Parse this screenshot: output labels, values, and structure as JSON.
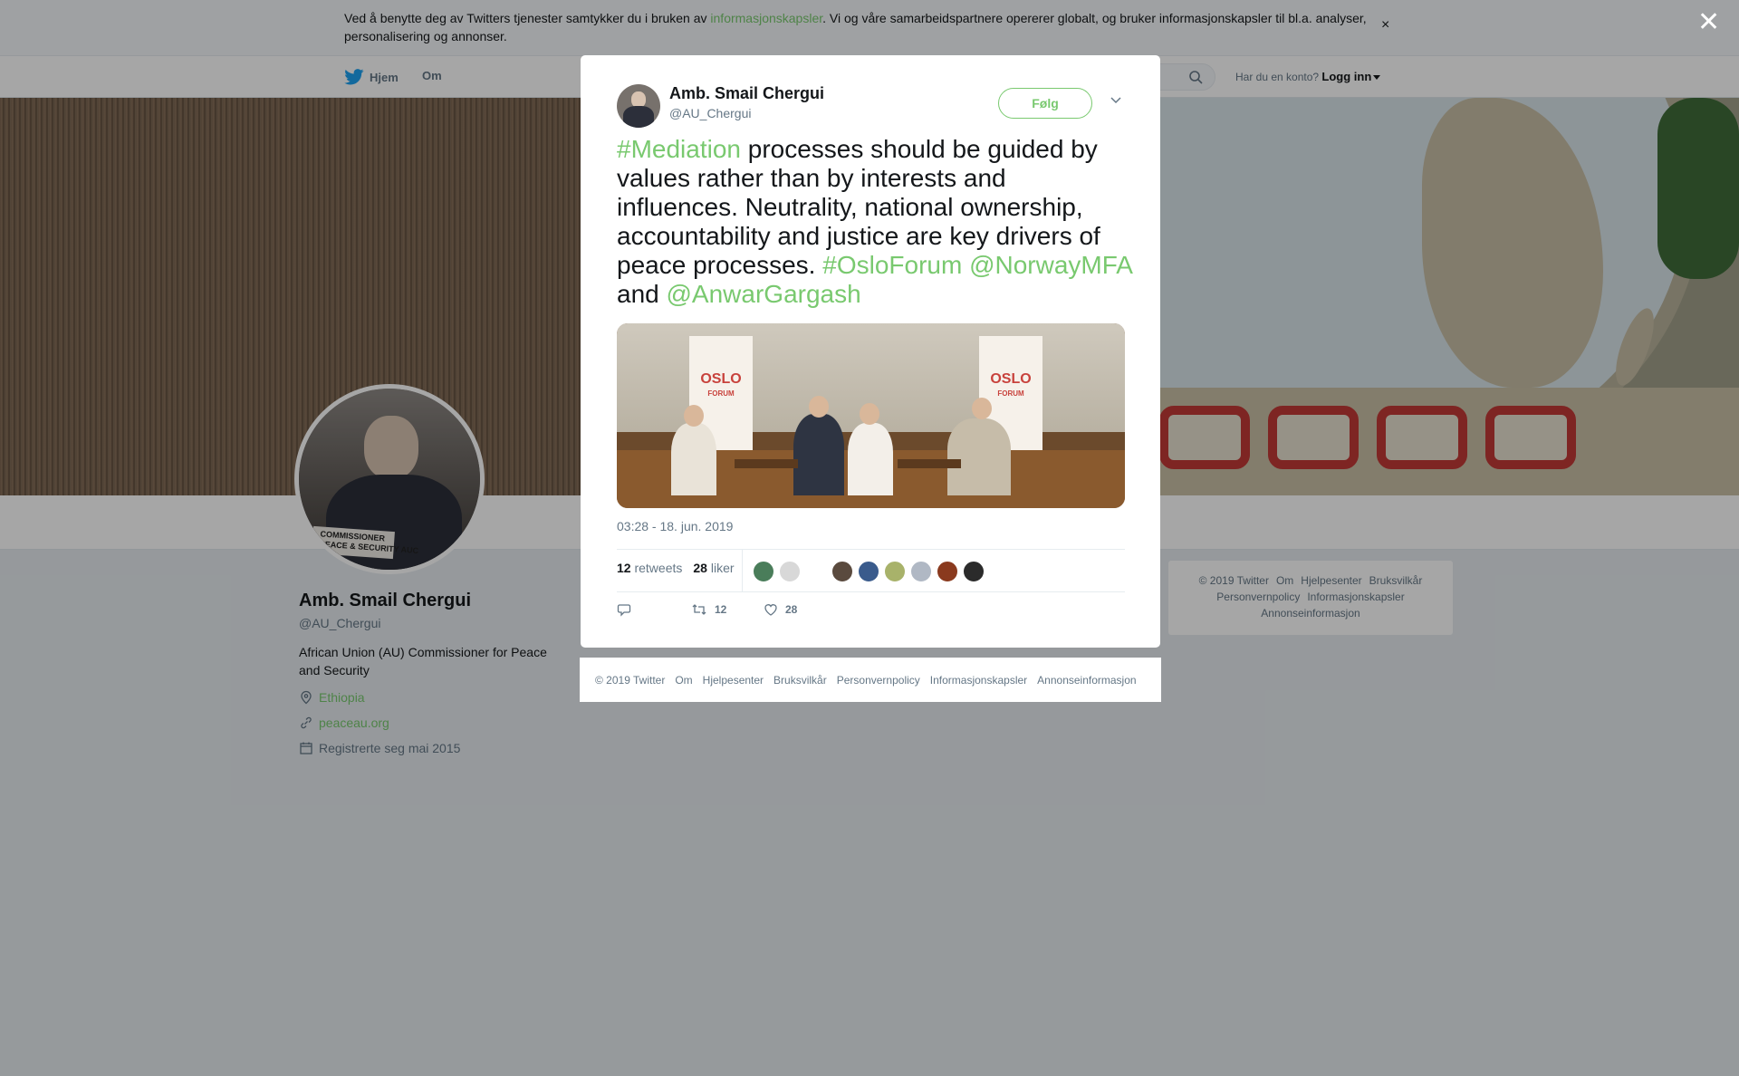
{
  "cookie_banner": {
    "text_before": "Ved å benytte deg av Twitters tjenester samtykker du i bruken av ",
    "link": "informasjonskapsler",
    "text_after": ". Vi og våre samarbeidspartnere opererer globalt, og bruker informasjonskapsler til bl.a. analyser, personalisering og annonser.",
    "close_glyph": "×"
  },
  "nav": {
    "home": "Hjem",
    "about": "Om",
    "account_prompt": "Har du en konto?",
    "login": "Logg inn"
  },
  "profile": {
    "name": "Amb. Smail Chergui",
    "handle": "@AU_Chergui",
    "bio": "African Union (AU) Commissioner for Peace and Security",
    "location": "Ethiopia",
    "website": "peaceau.org",
    "joined": "Registrerte seg mai 2015",
    "avatar_plate": "COMMISSIONER\nPEACE & SECURITY AUC"
  },
  "right_footer": {
    "items": [
      "© 2019 Twitter",
      "Om",
      "Hjelpesenter",
      "Bruksvilkår",
      "Personvernpolicy",
      "Informasjonskapsler",
      "Annonseinformasjon"
    ]
  },
  "tweet": {
    "author_name": "Amb. Smail Chergui",
    "author_handle": "@AU_Chergui",
    "follow_label": "Følg",
    "text": {
      "tag1": "#Mediation",
      "body": " processes should be guided by values rather than by interests and influences. Neutrality, national ownership, accountability and justice are key drivers of peace processes. ",
      "tag2": "#OsloForum",
      "mention1": "@NorwayMFA",
      "and": " and ",
      "mention2": "@AnwarGargash"
    },
    "photo_banner_text": "OSLO",
    "photo_banner_sub": "FORUM",
    "timestamp": "03:28 - 18. jun. 2019",
    "retweets_count": "12",
    "retweets_label": "retweets",
    "likes_count": "28",
    "likes_label": "liker",
    "action_retweets": "12",
    "action_likes": "28",
    "liker_colors": [
      "#4a7d5a",
      "#d8d8d8",
      "#ffffff",
      "#5a4a3e",
      "#3a5b8c",
      "#a8b26a",
      "#b0b8c4",
      "#8a3a1e",
      "#2b2b2b"
    ]
  },
  "modal_footer": {
    "items": [
      "© 2019 Twitter",
      "Om",
      "Hjelpesenter",
      "Bruksvilkår",
      "Personvernpolicy",
      "Informasjonskapsler",
      "Annonseinformasjon"
    ]
  },
  "overlay_close_glyph": "✕",
  "colors": {
    "accent": "#79c96f",
    "text_muted": "#657786",
    "text_primary": "#14171a"
  }
}
